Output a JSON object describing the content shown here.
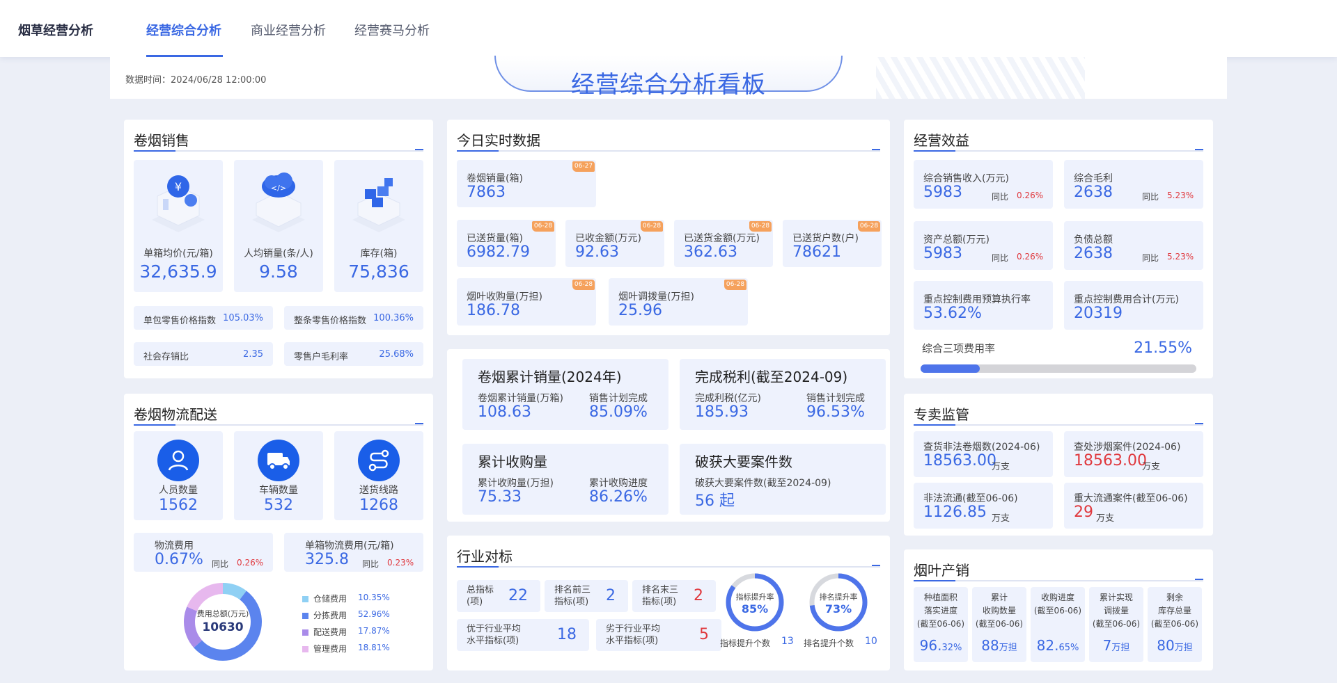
{
  "header": {
    "brand": "烟草经营分析",
    "tabs": [
      "经营综合分析",
      "商业经营分析",
      "经营赛马分析"
    ]
  },
  "banner": {
    "time": "数据时间：2024/06/28 12:00:00",
    "title": "经营综合分析看板"
  },
  "sales": {
    "title": "卷烟销售",
    "kpis": [
      {
        "label": "单箱均价(元/箱)",
        "value": "32,635.9"
      },
      {
        "label": "人均销量(条/人)",
        "value": "9.58"
      },
      {
        "label": "库存(箱)",
        "value": "75,836"
      }
    ],
    "indices": [
      {
        "label": "单包零售价格指数",
        "value": "105.03%"
      },
      {
        "label": "整条零售价格指数",
        "value": "100.36%"
      },
      {
        "label": "社会存销比",
        "value": "2.35"
      },
      {
        "label": "零售户毛利率",
        "value": "25.68%"
      }
    ]
  },
  "logistics": {
    "title": "卷烟物流配送",
    "kpis": [
      {
        "label": "人员数量",
        "value": "1562"
      },
      {
        "label": "车辆数量",
        "value": "532"
      },
      {
        "label": "送货线路",
        "value": "1268"
      }
    ],
    "cost": {
      "label": "物流费用",
      "value": "0.67%",
      "yoy_label": "同比",
      "yoy": "0.26%"
    },
    "unit_cost": {
      "label": "单箱物流费用(元/箱)",
      "value": "325.8",
      "yoy_label": "同比",
      "yoy": "0.23%"
    },
    "donut": {
      "center_label": "费用总额(万元)",
      "center_value": "10630"
    },
    "legend": [
      {
        "label": "仓储费用",
        "value": "10.35%",
        "color": "#8fd0f4"
      },
      {
        "label": "分拣费用",
        "value": "52.96%",
        "color": "#5b84ee"
      },
      {
        "label": "配送费用",
        "value": "17.87%",
        "color": "#a98be9"
      },
      {
        "label": "管理费用",
        "value": "18.81%",
        "color": "#e7b8ee"
      }
    ]
  },
  "realtime": {
    "title": "今日实时数据",
    "items": [
      {
        "label": "卷烟销量(箱)",
        "value": "7863",
        "badge": "06-27"
      },
      {
        "label": "已送货量(箱)",
        "value": "6982.79",
        "badge": "06-28"
      },
      {
        "label": "已收金额(万元)",
        "value": "92.63",
        "badge": "06-28"
      },
      {
        "label": "已送货金额(万元)",
        "value": "362.63",
        "badge": "06-28"
      },
      {
        "label": "已送货户数(户)",
        "value": "78621",
        "badge": "06-28"
      },
      {
        "label": "烟叶收购量(万担)",
        "value": "186.78",
        "badge": "06-28"
      },
      {
        "label": "烟叶调拨量(万担)",
        "value": "25.96",
        "badge": "06-28"
      }
    ]
  },
  "cumulative": {
    "blocks": [
      {
        "title": "卷烟累计销量(2024年)",
        "items": [
          {
            "label": "卷烟累计销量(万箱)",
            "value": "108.63"
          },
          {
            "label": "销售计划完成",
            "value": "85.09%"
          }
        ]
      },
      {
        "title": "完成税利(截至2024-09)",
        "items": [
          {
            "label": "完成利税(亿元)",
            "value": "185.93"
          },
          {
            "label": "销售计划完成",
            "value": "96.53%"
          }
        ]
      },
      {
        "title": "累计收购量",
        "items": [
          {
            "label": "累计收购量(万担)",
            "value": "75.33"
          },
          {
            "label": "累计收购进度",
            "value": "86.26%"
          }
        ]
      },
      {
        "title": "破获大要案件数",
        "items": [
          {
            "label": "破获大要案件数(截至2024-09)",
            "value": "56 起"
          }
        ]
      }
    ]
  },
  "benchmark": {
    "title": "行业对标",
    "cards": [
      {
        "label": "总指标\n(项)",
        "value": "22"
      },
      {
        "label": "排名前三\n指标(项)",
        "value": "2"
      },
      {
        "label": "排名末三\n指标(项)",
        "value": "2"
      },
      {
        "label": "优于行业平均\n水平指标(项)",
        "value": "18"
      },
      {
        "label": "劣于行业平均\n水平指标(项)",
        "value": "5"
      }
    ],
    "rings": [
      {
        "title": "指标提升率",
        "pct": "85%",
        "fraction": 0.85,
        "sub_label": "指标提升个数",
        "sub_value": "13"
      },
      {
        "title": "排名提升率",
        "pct": "73%",
        "fraction": 0.73,
        "sub_label": "排名提升个数",
        "sub_value": "10"
      }
    ]
  },
  "benefit": {
    "title": "经营效益",
    "cards": [
      {
        "label": "综合销售收入(万元)",
        "value": "5983",
        "yoy_label": "同比",
        "yoy": "0.26%"
      },
      {
        "label": "综合毛利",
        "value": "2638",
        "yoy_label": "同比",
        "yoy": "5.23%"
      },
      {
        "label": "资产总额(万元)",
        "value": "5983",
        "yoy_label": "同比",
        "yoy": "0.26%"
      },
      {
        "label": "负债总额",
        "value": "2638",
        "yoy_label": "同比",
        "yoy": "5.23%"
      },
      {
        "label": "重点控制费用预算执行率",
        "value": "53.62%"
      },
      {
        "label": "重点控制费用合计(万元)",
        "value": "20319"
      }
    ],
    "rate": {
      "label": "综合三项费用率",
      "value": "21.55%",
      "fraction": 0.2155
    }
  },
  "monopoly": {
    "title": "专卖监管",
    "cards": [
      {
        "label": "查货非法卷烟数(2024-06)",
        "value": "18563.00",
        "unit": "万支",
        "red": false
      },
      {
        "label": "查处涉烟案件(2024-06)",
        "value": "18563.00",
        "unit": "万支",
        "red": true
      },
      {
        "label": "非法流通(截至06-06)",
        "value": "1126.85",
        "unit": "万支",
        "red": false
      },
      {
        "label": "重大流通案件(截至06-06)",
        "value": "29",
        "unit": "万支",
        "red": true
      }
    ]
  },
  "leaf": {
    "title": "烟叶产销",
    "cards": [
      {
        "label": "种植面积\n落实进度\n(截至06-06)",
        "value": "96.",
        "value_small": "32%"
      },
      {
        "label": "累计\n收购数量\n(截至06-06)",
        "value": "88",
        "value_small": "万担"
      },
      {
        "label": "收购进度\n(截至06-06)",
        "value": "82.",
        "value_small": "65%"
      },
      {
        "label": "累计实现\n调拨量\n(截至06-06)",
        "value": "7",
        "value_small": "万担"
      },
      {
        "label": "剩余\n库存总量\n(截至06-06)",
        "value": "80",
        "value_small": "万担"
      }
    ]
  }
}
